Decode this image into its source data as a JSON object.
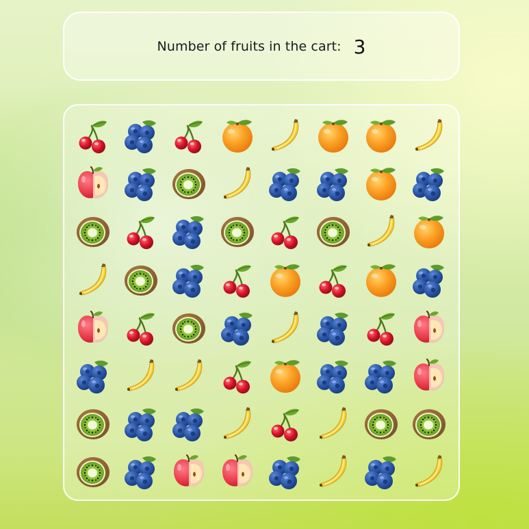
{
  "cart": {
    "label": "Number of fruits in the cart:",
    "count": "3"
  },
  "board": {
    "columns": 8,
    "rows": [
      [
        "cherry",
        "blueberry",
        "cherry",
        "orange",
        "banana",
        "orange",
        "orange",
        "banana"
      ],
      [
        "apple",
        "blueberry",
        "kiwi",
        "banana",
        "blueberry",
        "blueberry",
        "orange",
        "blueberry"
      ],
      [
        "kiwi",
        "cherry",
        "blueberry",
        "kiwi",
        "cherry",
        "kiwi",
        "banana",
        "orange"
      ],
      [
        "banana",
        "kiwi",
        "blueberry",
        "cherry",
        "orange",
        "cherry",
        "orange",
        "blueberry"
      ],
      [
        "apple",
        "cherry",
        "kiwi",
        "blueberry",
        "banana",
        "blueberry",
        "cherry",
        "apple"
      ],
      [
        "blueberry",
        "banana",
        "banana",
        "cherry",
        "orange",
        "blueberry",
        "blueberry",
        "apple"
      ],
      [
        "kiwi",
        "blueberry",
        "blueberry",
        "banana",
        "cherry",
        "banana",
        "kiwi",
        "kiwi"
      ],
      [
        "kiwi",
        "blueberry",
        "apple",
        "apple",
        "blueberry",
        "banana",
        "blueberry",
        "banana"
      ]
    ]
  },
  "icon_names": {
    "cherry": "cherry-icon",
    "blueberry": "blueberry-icon",
    "orange": "orange-icon",
    "banana": "banana-icon",
    "apple": "apple-icon",
    "kiwi": "kiwi-icon"
  },
  "colors": {
    "cherry": "#d0152a",
    "blueberry": "#2a55a6",
    "orange": "#f7931e",
    "banana": "#f6cf3a",
    "apple": "#ea3a4a",
    "kiwi": "#6b8e23"
  }
}
